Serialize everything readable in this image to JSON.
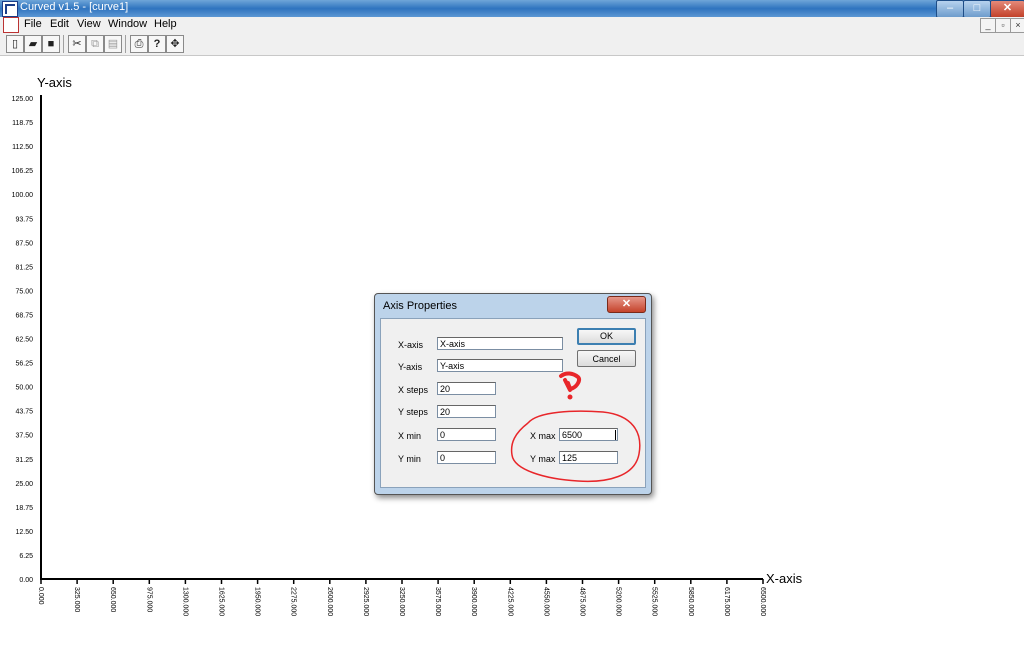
{
  "window": {
    "title": "Curved v1.5 - [curve1]"
  },
  "window_controls": {
    "minimize": "–",
    "maximize": "□",
    "close": "✕"
  },
  "mdi_controls": {
    "minimize": "_",
    "restore": "▫",
    "close": "×"
  },
  "menu": [
    "File",
    "Edit",
    "View",
    "Window",
    "Help"
  ],
  "toolbar": {
    "buttons": [
      {
        "name": "new-file-icon",
        "glyph": "▯"
      },
      {
        "name": "open-folder-icon",
        "glyph": "▰"
      },
      {
        "name": "save-icon",
        "glyph": "■"
      },
      {
        "name": "cut-icon",
        "glyph": "✂"
      },
      {
        "name": "copy-icon",
        "glyph": "⧉"
      },
      {
        "name": "paste-icon",
        "glyph": "▤"
      },
      {
        "name": "print-icon",
        "glyph": "⎙"
      },
      {
        "name": "help-icon",
        "glyph": "?"
      },
      {
        "name": "move-icon",
        "glyph": "✥"
      }
    ]
  },
  "chart_data": {
    "type": "line",
    "title": "",
    "xlabel": "X-axis",
    "ylabel": "Y-axis",
    "xlim": [
      0,
      6500
    ],
    "ylim": [
      0,
      125
    ],
    "x_steps": 20,
    "y_steps": 20,
    "x_ticks": [
      "0.000",
      "325.000",
      "650.000",
      "975.000",
      "1300.000",
      "1625.000",
      "1950.000",
      "2275.000",
      "2600.000",
      "2925.000",
      "3250.000",
      "3575.000",
      "3900.000",
      "4225.000",
      "4550.000",
      "4875.000",
      "5200.000",
      "5525.000",
      "5850.000",
      "6175.000",
      "6500.000"
    ],
    "y_ticks": [
      "0.00",
      "6.25",
      "12.50",
      "18.75",
      "25.00",
      "31.25",
      "37.50",
      "43.75",
      "50.00",
      "56.25",
      "62.50",
      "68.75",
      "75.00",
      "81.25",
      "87.50",
      "93.75",
      "100.00",
      "106.25",
      "112.50",
      "118.75",
      "125.00"
    ],
    "grid": false,
    "series": []
  },
  "dialog": {
    "title": "Axis Properties",
    "close": "✕",
    "fields": {
      "x_axis": {
        "label": "X-axis",
        "value": "X-axis"
      },
      "y_axis": {
        "label": "Y-axis",
        "value": "Y-axis"
      },
      "x_steps": {
        "label": "X steps",
        "value": "20"
      },
      "y_steps": {
        "label": "Y steps",
        "value": "20"
      },
      "x_min": {
        "label": "X min",
        "value": "0"
      },
      "y_min": {
        "label": "Y min",
        "value": "0"
      },
      "x_max": {
        "label": "X max",
        "value": "6500"
      },
      "y_max": {
        "label": "Y max",
        "value": "125"
      }
    },
    "ok": "OK",
    "cancel": "Cancel"
  },
  "annotation_color": "#e8262a"
}
